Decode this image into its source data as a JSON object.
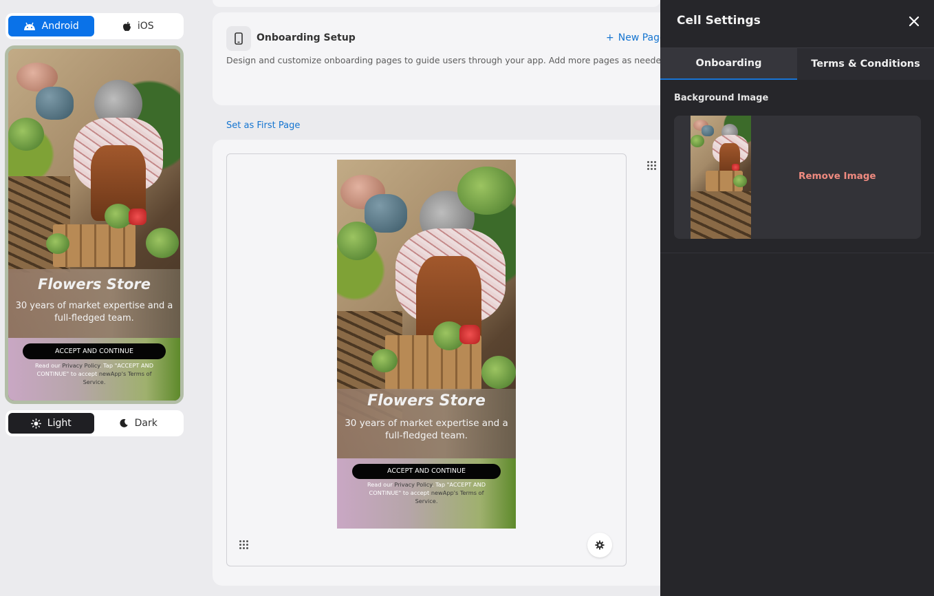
{
  "platform_toggle": {
    "android": "Android",
    "ios": "iOS",
    "selected": "Android"
  },
  "theme_toggle": {
    "light": "Light",
    "dark": "Dark",
    "selected": "Light"
  },
  "onboarding_preview": {
    "title": "Flowers Store",
    "subtitle": "30 years of market expertise and a full-fledged team.",
    "accept_button": "ACCEPT AND CONTINUE",
    "legal_read": "Read our",
    "legal_privacy": "Privacy Policy",
    "legal_tap": ". Tap \"ACCEPT AND CONTINUE\" to accept",
    "legal_terms": "newApp's Terms of Service."
  },
  "setup_card": {
    "icon": "phone-icon",
    "title": "Onboarding Setup",
    "new_page_label": "New Page",
    "description": "Design and customize onboarding pages to guide users through your app. Add more pages as needed!"
  },
  "set_first_page": "Set as First Page",
  "settings_panel": {
    "title": "Cell Settings",
    "tabs": [
      "Onboarding",
      "Terms & Conditions"
    ],
    "active_tab": "Onboarding",
    "background_label": "Background Image",
    "remove_image": "Remove Image"
  },
  "colors": {
    "accent_blue": "#0a72e8",
    "link_blue": "#1474d0",
    "panel_bg": "#26262a",
    "remove_red": "#f08b80"
  }
}
